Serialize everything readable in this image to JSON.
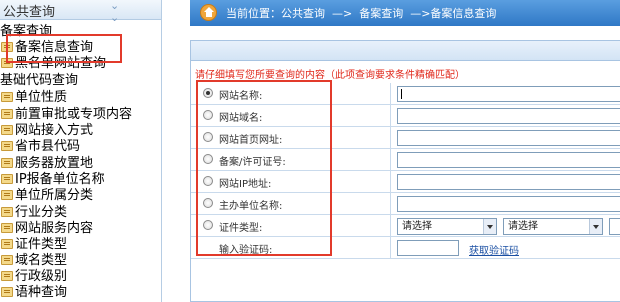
{
  "sidebar": {
    "header": "公共查询",
    "header_icon": "double-chevron-down-icon",
    "lines": [
      {
        "kind": "category",
        "label": "备案查询"
      },
      {
        "kind": "item",
        "label": "备案信息查询",
        "active": true
      },
      {
        "kind": "item",
        "label": "黑名单网站查询"
      },
      {
        "kind": "category",
        "label": "基础代码查询"
      },
      {
        "kind": "item",
        "label": "单位性质"
      },
      {
        "kind": "item",
        "label": "前置审批或专项内容"
      },
      {
        "kind": "item",
        "label": "网站接入方式"
      },
      {
        "kind": "item",
        "label": "省市县代码"
      },
      {
        "kind": "item",
        "label": "服务器放置地"
      },
      {
        "kind": "item",
        "label": "IP报备单位名称"
      },
      {
        "kind": "item",
        "label": "单位所属分类"
      },
      {
        "kind": "item",
        "label": "行业分类"
      },
      {
        "kind": "item",
        "label": "网站服务内容"
      },
      {
        "kind": "item",
        "label": "证件类型"
      },
      {
        "kind": "item",
        "label": "域名类型"
      },
      {
        "kind": "item",
        "label": "行政级别"
      },
      {
        "kind": "item",
        "label": "语种查询"
      }
    ]
  },
  "breadcrumb": {
    "text": "当前位置：公共查询  —>  备案查询  —>备案信息查询",
    "icon": "home-icon"
  },
  "form": {
    "notice": "请仔细填写您所要查询的内容（此项查询要求条件精确匹配）",
    "rows": [
      {
        "label": "网站名称:",
        "checked": true,
        "type": "text"
      },
      {
        "label": "网站域名:",
        "checked": false,
        "type": "text"
      },
      {
        "label": "网站首页网址:",
        "checked": false,
        "type": "text"
      },
      {
        "label": "备案/许可证号:",
        "checked": false,
        "type": "text"
      },
      {
        "label": "网站IP地址:",
        "checked": false,
        "type": "text"
      },
      {
        "label": "主办单位名称:",
        "checked": false,
        "type": "text"
      },
      {
        "label": "证件类型:",
        "checked": false,
        "type": "selects",
        "select1": "请选择",
        "select2": "请选择"
      }
    ],
    "captcha_label": "输入验证码:",
    "captcha_link": "获取验证码"
  },
  "colors": {
    "highlight_border": "#e23a2b",
    "breadcrumb_bg": "#3a84cf",
    "notice_text": "#e0281b",
    "link": "#1a4fa3"
  }
}
